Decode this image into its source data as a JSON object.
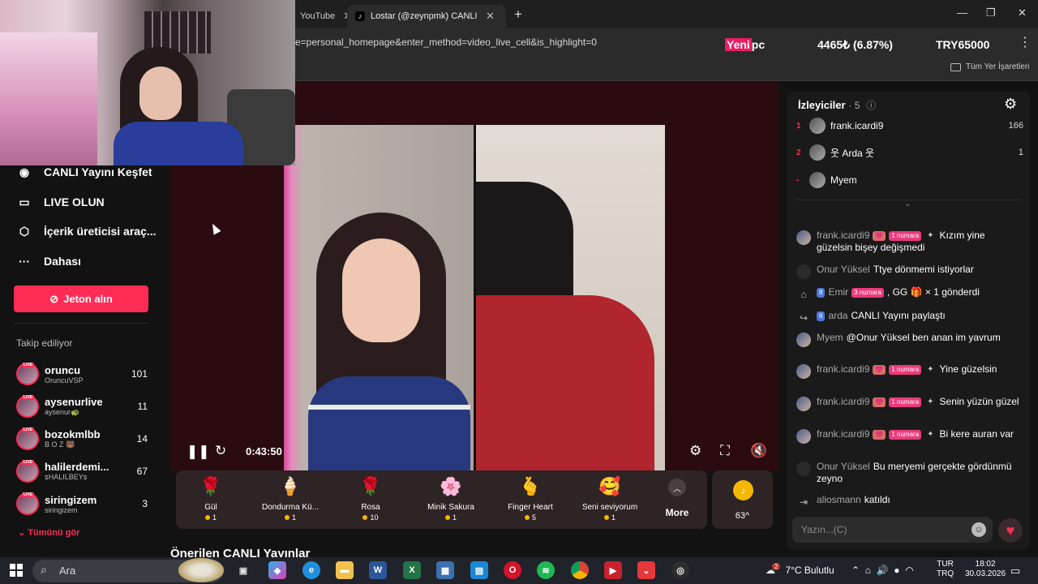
{
  "browser": {
    "tabs": [
      {
        "label": "YouTube",
        "close": "✕"
      },
      {
        "label": "Lostar (@zeynpmk) CANLI Y",
        "close": "✕"
      }
    ],
    "new_tab": "+",
    "address": "e=personal_homepage&enter_method=video_live_cell&is_highlight=0",
    "window_controls": [
      "—",
      "❐",
      "✕"
    ],
    "bookmarks_all": "Tüm Yer İşaretleri"
  },
  "ticker": {
    "label_pink": "Yeni",
    "label_rest": " pc",
    "amount": "4465₺ (6.87%)",
    "goal": "TRY65000"
  },
  "sidebar": {
    "nav": [
      {
        "label": "CANLI Yayını Keşfet",
        "icon": "live-explore-icon"
      },
      {
        "label": "LIVE OLUN",
        "icon": "camera-icon"
      },
      {
        "label": "İçerik üreticisi araç...",
        "icon": "creator-tools-icon"
      },
      {
        "label": "Dahası",
        "icon": "more-dots-icon"
      }
    ],
    "jeton_button": "Jeton alın",
    "following_title": "Takip ediliyor",
    "following": [
      {
        "name": "oruncu",
        "sub": "OruncuVSP",
        "count": "101"
      },
      {
        "name": "aysenurlive",
        "sub": "aysenur🐢",
        "count": "11"
      },
      {
        "name": "bozokmlbb",
        "sub": "B O Z 🐻",
        "count": "14"
      },
      {
        "name": "halilerdemi...",
        "sub": "ꜱHALILBEYꜱ",
        "count": "67"
      },
      {
        "name": "siringizem",
        "sub": "siringizem",
        "count": "3"
      }
    ],
    "live_badge": "LIVE",
    "see_all": "Tümünü gör"
  },
  "video": {
    "time": "0:43:50"
  },
  "gifts": [
    {
      "emoji": "🌹",
      "name": "Gül",
      "price": "1"
    },
    {
      "emoji": "🍦",
      "name": "Dondurma Kü...",
      "price": "1"
    },
    {
      "emoji": "🌹",
      "name": "Rosa",
      "price": "10"
    },
    {
      "emoji": "🌸",
      "name": "Minik Sakura",
      "price": "1"
    },
    {
      "emoji": "🫰",
      "name": "Finger Heart",
      "price": "5"
    },
    {
      "emoji": "🥰",
      "name": "Seni seviyorum",
      "price": "1"
    }
  ],
  "more_label": "More",
  "coins": {
    "count": "63",
    "caret": "^"
  },
  "recommended": "Önerilen CANLI Yayınlar",
  "chat": {
    "title": "İzleyiciler",
    "viewer_count": "· 5",
    "viewers": [
      {
        "rank": "1",
        "name": "frank.icardi9",
        "score": "166"
      },
      {
        "rank": "2",
        "name": "웃 Arda 웃",
        "score": "1"
      },
      {
        "rank": "-",
        "name": "Myem",
        "score": ""
      }
    ],
    "messages": [
      {
        "user": "frank.icardi9",
        "badges": [
          "💗",
          "1 numara",
          "✦"
        ],
        "text": "Kızım yine güzelsin bişey değişmedi"
      },
      {
        "user": "Onur Yüksel",
        "badges": [],
        "text": "Ttye dönmemi istiyorlar"
      },
      {
        "user": "Emir",
        "badges": [
          "8",
          "3 numara"
        ],
        "text": ", GG 🎁 × 1 gönderdi"
      },
      {
        "user": "arda",
        "badges": [
          "6"
        ],
        "text": "CANLI Yayını paylaştı"
      },
      {
        "user": "Myem",
        "badges": [],
        "text": "@Onur Yüksel ben anan im yavrum"
      },
      {
        "user": "frank.icardi9",
        "badges": [
          "💗",
          "1 numara",
          "✦"
        ],
        "text": "Yine güzelsin"
      },
      {
        "user": "frank.icardi9",
        "badges": [
          "💗",
          "1 numara",
          "✦"
        ],
        "text": "Senin yüzün güzel"
      },
      {
        "user": "frank.icardi9",
        "badges": [
          "💗",
          "1 numara",
          "✦"
        ],
        "text": "Bi kere auran var"
      },
      {
        "user": "Onur Yüksel",
        "badges": [],
        "text": "Bu meryemi gerçekte gördünmü zeyno"
      },
      {
        "user": "aliosmann",
        "badges": [],
        "text": "katıldı"
      }
    ],
    "input_placeholder": "Yazın...(C)"
  },
  "taskbar": {
    "search": "Ara",
    "weather": "7°C Bulutlu",
    "weather_badge": "2",
    "lang_top": "TUR",
    "lang_bottom": "TRQ",
    "time": "18:02",
    "date": "30.03.2026"
  }
}
